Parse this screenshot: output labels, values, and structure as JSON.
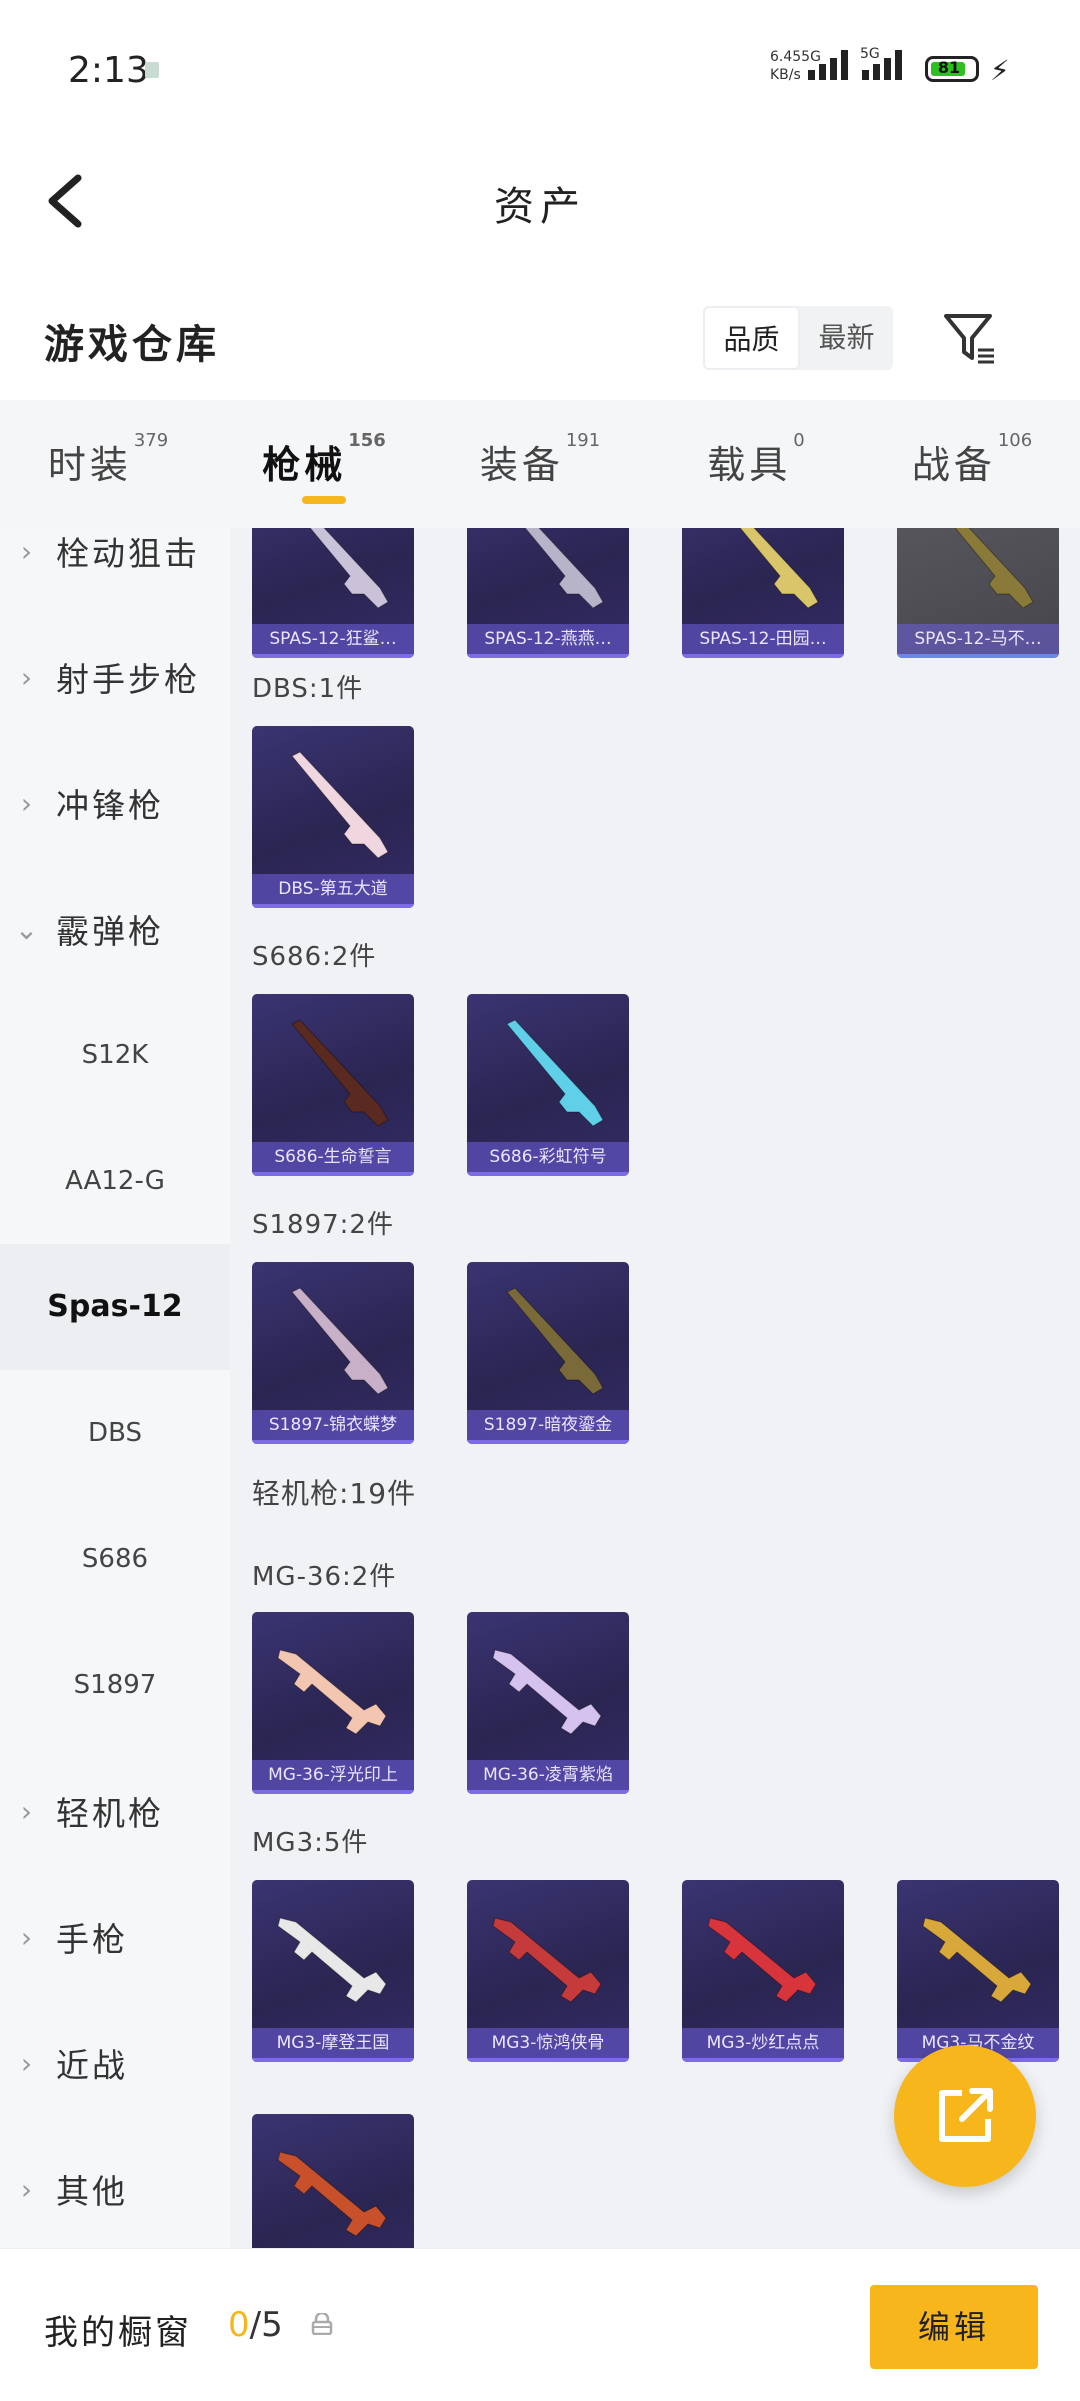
{
  "status": {
    "time": "2:13",
    "net_speed": "6.45",
    "net_unit": "KB/s",
    "net_type_1": "5G",
    "net_type_2": "5G",
    "battery": "81"
  },
  "nav": {
    "title": "资产"
  },
  "section": {
    "title": "游戏仓库",
    "sort_quality": "品质",
    "sort_newest": "最新"
  },
  "tabs": [
    {
      "label": "时装",
      "count": "379"
    },
    {
      "label": "枪械",
      "count": "156"
    },
    {
      "label": "装备",
      "count": "191"
    },
    {
      "label": "载具",
      "count": "0"
    },
    {
      "label": "战备",
      "count": "106"
    }
  ],
  "sidebar": {
    "items": [
      "栓动狙击",
      "射手步枪",
      "冲锋枪",
      "霰弹枪",
      "S12K",
      "AA12-G",
      "Spas-12",
      "DBS",
      "S686",
      "S1897",
      "轻机枪",
      "手枪",
      "近战",
      "其他"
    ]
  },
  "groups": {
    "dbs": "DBS:1件",
    "s686": "S686:2件",
    "s1897": "S1897:2件",
    "lmg": "轻机枪:19件",
    "mg36": "MG-36:2件",
    "mg3": "MG3:5件"
  },
  "cards": [
    "SPAS-12-狂鲨…",
    "SPAS-12-燕燕…",
    "SPAS-12-田园…",
    "SPAS-12-马不…",
    "DBS-第五大道",
    "S686-生命誓言",
    "S686-彩虹符号",
    "S1897-锦衣蝶梦",
    "S1897-暗夜鎏金",
    "MG-36-浮光印上",
    "MG-36-凌霄紫焰",
    "MG3-摩登王国",
    "MG3-惊鸿侠骨",
    "MG3-炒红点点",
    "MG3-马不金纹",
    ""
  ],
  "gun_colors": [
    "#c9c2d8",
    "#b7b3c8",
    "#d9c56a",
    "#8a7a3a",
    "#f0d6df",
    "#5a2a20",
    "#5fd0e8",
    "#c8b0c8",
    "#7a6a3a",
    "#f2c6b0",
    "#d6c2ee",
    "#e8e8e8",
    "#c53a3a",
    "#d8343c",
    "#d8a93a",
    "#c8502a"
  ],
  "showcase": {
    "label": "我的橱窗",
    "current": "0",
    "total": "/5",
    "edit": "编辑"
  }
}
